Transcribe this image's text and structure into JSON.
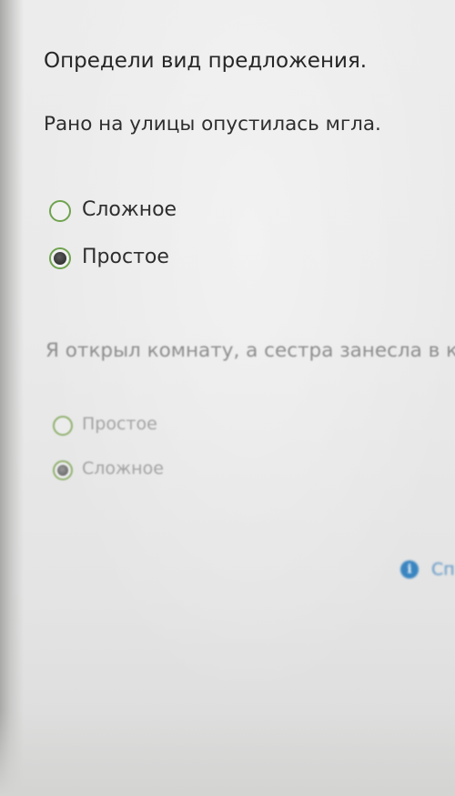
{
  "question1": {
    "instruction": "Определи вид предложения.",
    "sentence": "Рано на улицы опустилась мгла.",
    "options": [
      {
        "label": "Сложное",
        "selected": false
      },
      {
        "label": "Простое",
        "selected": true
      }
    ]
  },
  "question2": {
    "sentence": "Я открыл комнату, а сестра занесла в к",
    "options": [
      {
        "label": "Простое",
        "selected": false
      },
      {
        "label": "Сложное",
        "selected": true
      }
    ]
  },
  "hint": {
    "icon": "info-icon",
    "label": "Сп"
  },
  "colors": {
    "radio_border": "#6fa34f",
    "radio_fill": "#3a3a3a",
    "info_blue": "#3a85c0"
  }
}
